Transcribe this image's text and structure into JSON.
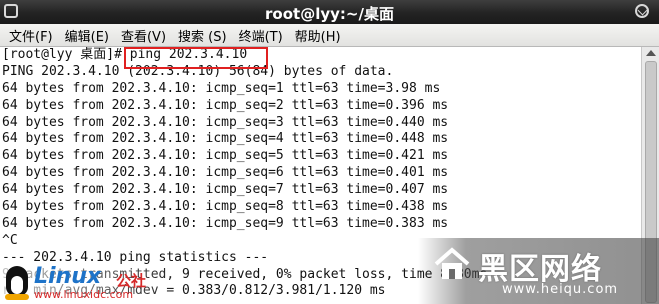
{
  "window": {
    "title": "root@lyy:~/桌面"
  },
  "menu": [
    {
      "label": "文件(F)"
    },
    {
      "label": "编辑(E)"
    },
    {
      "label": "查看(V)"
    },
    {
      "label": "搜索 (S)"
    },
    {
      "label": "终端(T)"
    },
    {
      "label": "帮助(H)"
    }
  ],
  "terminal": {
    "lines": [
      "[root@lyy 桌面]# ping 202.3.4.10",
      "PING 202.3.4.10 (202.3.4.10) 56(84) bytes of data.",
      "64 bytes from 202.3.4.10: icmp_seq=1 ttl=63 time=3.98 ms",
      "64 bytes from 202.3.4.10: icmp_seq=2 ttl=63 time=0.396 ms",
      "64 bytes from 202.3.4.10: icmp_seq=3 ttl=63 time=0.440 ms",
      "64 bytes from 202.3.4.10: icmp_seq=4 ttl=63 time=0.448 ms",
      "64 bytes from 202.3.4.10: icmp_seq=5 ttl=63 time=0.421 ms",
      "64 bytes from 202.3.4.10: icmp_seq=6 ttl=63 time=0.401 ms",
      "64 bytes from 202.3.4.10: icmp_seq=7 ttl=63 time=0.407 ms",
      "64 bytes from 202.3.4.10: icmp_seq=8 ttl=63 time=0.438 ms",
      "64 bytes from 202.3.4.10: icmp_seq=9 ttl=63 time=0.383 ms",
      "^C",
      "--- 202.3.4.10 ping statistics ---",
      "9 packets transmitted, 9 received, 0% packet loss, time 8480ms",
      "rtt min/avg/max/mdev = 0.383/0.812/3.981/1.120 ms"
    ]
  },
  "watermarks": {
    "linux_brand": "Linux",
    "linux_brand_cn": "公社",
    "linux_url": "www.linuxidc.com",
    "heiqu_brand": "黑区网络",
    "heiqu_url": "www.heiqu.com"
  },
  "colors": {
    "titlebar": "#2a2a2a",
    "highlight_box": "#e02020",
    "linux_blue": "#1e73c8",
    "linux_red": "#d62a2a"
  }
}
